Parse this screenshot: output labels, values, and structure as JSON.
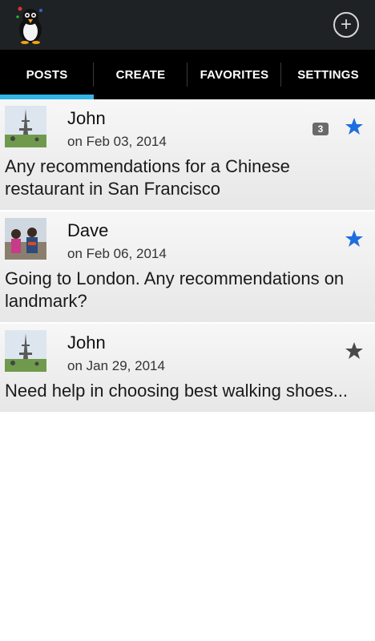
{
  "header": {
    "add_icon": "plus-circle-icon",
    "logo_icon": "penguin-logo-icon"
  },
  "tabs": [
    {
      "label": "POSTS",
      "active": true
    },
    {
      "label": "CREATE",
      "active": false
    },
    {
      "label": "FAVORITES",
      "active": false
    },
    {
      "label": "SETTINGS",
      "active": false
    }
  ],
  "posts": [
    {
      "author": "John",
      "date": "on Feb 03, 2014",
      "badge": "3",
      "starred": true,
      "text": "Any recommendations for a Chinese restaurant in San Francisco",
      "avatar": "eiffel-tower-photo"
    },
    {
      "author": "Dave",
      "date": "on Feb 06, 2014",
      "badge": "",
      "starred": true,
      "text": "Going to London. Any recommendations on landmark?",
      "avatar": "kids-photo"
    },
    {
      "author": "John",
      "date": "on Jan 29, 2014",
      "badge": "",
      "starred": false,
      "text": "Need help in choosing best walking shoes...",
      "avatar": "eiffel-tower-photo"
    }
  ],
  "colors": {
    "accent": "#33b5e5",
    "star_on": "#1e6ee0",
    "star_off": "#4a4a4a"
  }
}
